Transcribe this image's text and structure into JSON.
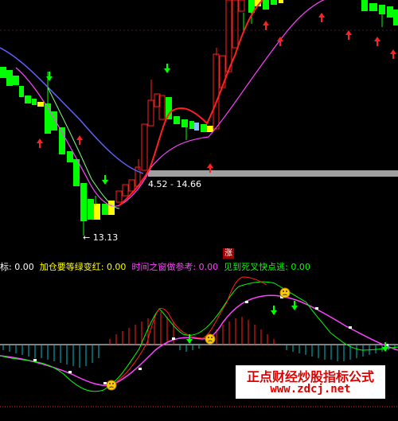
{
  "main_chart": {
    "range_label": "4.52 - 14.66",
    "low_label": "← 13.13",
    "limit_up_badge": "涨"
  },
  "indicator_bar": {
    "items": [
      {
        "label": "标:",
        "value": "0.00",
        "color": "#ffffff"
      },
      {
        "label": "加仓要等绿变红:",
        "value": "0.00",
        "color": "#ffff00"
      },
      {
        "label": "时间之窗做参考:",
        "value": "0.00",
        "color": "#ff40ff"
      },
      {
        "label": "见到死叉快点逃:",
        "value": "0.00",
        "color": "#00ff00"
      }
    ]
  },
  "watermark": {
    "line1": "正点财经炒股指标公式",
    "line2": "www.zdcj.net"
  },
  "colors": {
    "up": "#ff2020",
    "down_candle": "#00ff00",
    "ma_blue": "#6060ff",
    "ma_magenta": "#ff40ff",
    "ma_green": "#80ff80",
    "bg": "#000000",
    "support_band": "#a0a0a0"
  },
  "icons": [
    "up-arrow-icon",
    "down-arrow-icon",
    "sad-face-icon"
  ]
}
